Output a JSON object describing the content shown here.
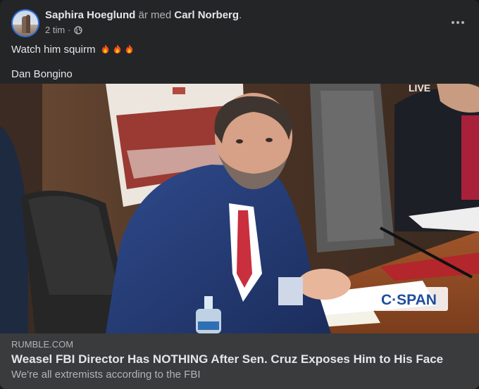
{
  "post": {
    "author": "Saphira Hoeglund",
    "with_connector": "är med",
    "tagged": "Carl Norberg",
    "period": ".",
    "time": "2 tim",
    "dot": "·",
    "audience_icon": "globe-icon",
    "more_icon": "more-options-icon",
    "text_line1": "Watch him squirm",
    "emoji": [
      "fire-emoji",
      "fire-emoji",
      "fire-emoji"
    ],
    "text_line2": "Dan Bongino"
  },
  "video": {
    "live_label": "LIVE",
    "network_logo": "C·SPAN"
  },
  "link": {
    "domain": "RUMBLE.COM",
    "title": "Weasel FBI Director Has NOTHING After Sen. Cruz Exposes Him to His Face",
    "description": "We're all extremists according to the FBI"
  },
  "colors": {
    "card_bg": "#242526",
    "link_bg": "#3a3b3c",
    "text_primary": "#e4e6eb",
    "text_secondary": "#b0b3b8",
    "cspan_blue": "#1f4e9c"
  }
}
